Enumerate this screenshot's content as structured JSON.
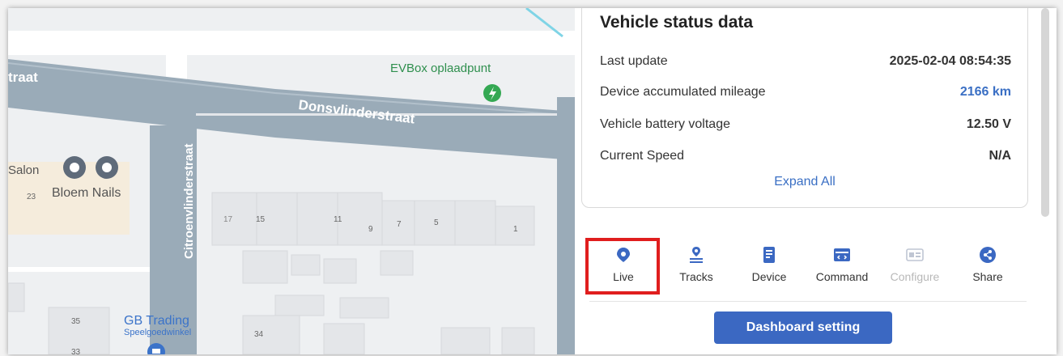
{
  "map": {
    "labels": {
      "street_left": "traat",
      "donsvlinder": "Donsvlinderstraat",
      "citroen": "Citroenvlinderstraat",
      "evbox": "EVBox oplaadpunt",
      "salon": "Salon",
      "bloem": "Bloem Nails",
      "gb_trading": "GB Trading",
      "speelgoed": "Speelgoedwinkel",
      "n23": "23",
      "n17": "17",
      "n15": "15",
      "n11": "11",
      "n9": "9",
      "n7": "7",
      "n5": "5",
      "n1": "1",
      "n35": "35",
      "n34": "34",
      "n33": "33"
    }
  },
  "status": {
    "title": "Vehicle status data",
    "rows": [
      {
        "label": "Last update",
        "value": "2025-02-04 08:54:35"
      },
      {
        "label": "Device accumulated mileage",
        "value": "2166 km"
      },
      {
        "label": "Vehicle battery voltage",
        "value": "12.50 V"
      },
      {
        "label": "Current Speed",
        "value": "N/A"
      }
    ],
    "expand_label": "Expand All"
  },
  "toolbar": {
    "items": [
      {
        "label": "Live",
        "icon": "live-pin-icon"
      },
      {
        "label": "Tracks",
        "icon": "tracks-route-icon"
      },
      {
        "label": "Device",
        "icon": "device-doc-icon"
      },
      {
        "label": "Command",
        "icon": "command-icon"
      },
      {
        "label": "Configure",
        "icon": "configure-icon"
      },
      {
        "label": "Share",
        "icon": "share-icon"
      }
    ]
  },
  "dashboard_button": "Dashboard setting",
  "colors": {
    "accent": "#3b68c2",
    "highlight": "#e01e1e",
    "road": "#9aabb8",
    "link_blue": "#3a6fc4"
  }
}
